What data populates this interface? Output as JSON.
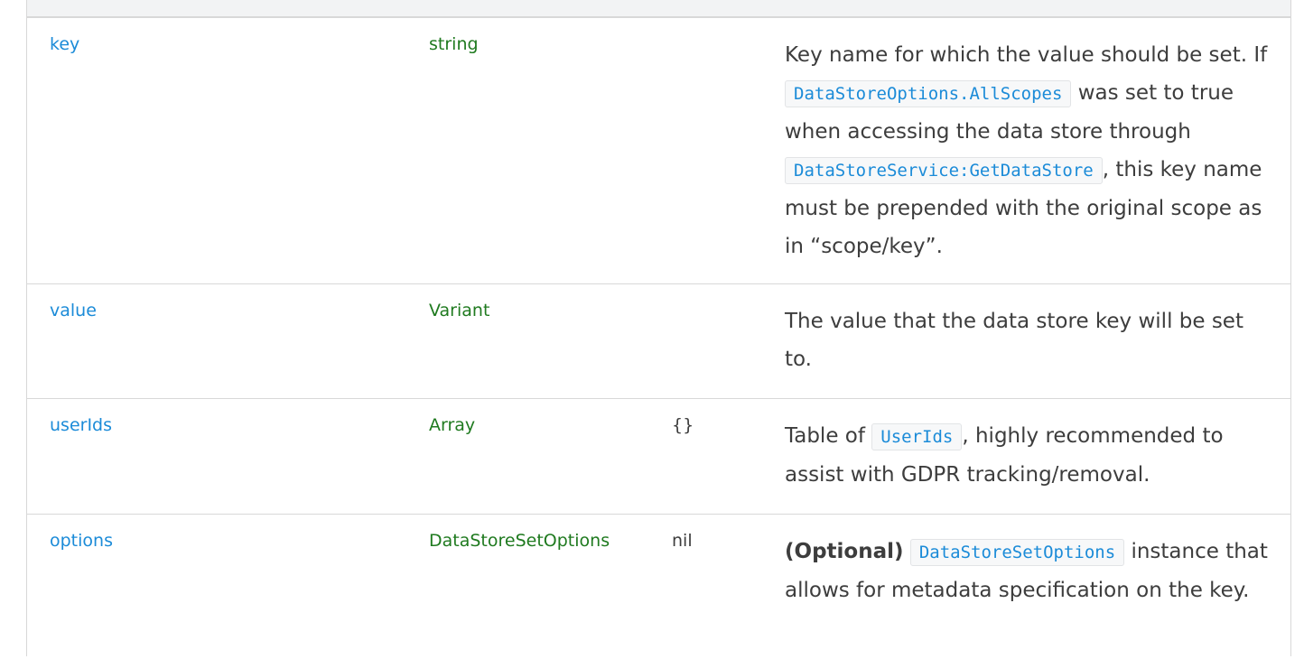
{
  "rows": [
    {
      "name": "key",
      "type": "string",
      "default": "",
      "desc": {
        "t1": "Key name for which the value should be set. If ",
        "code1": "DataStoreOptions.AllScopes",
        "t2": " was set to true when accessing the data store through ",
        "code2": "DataStoreService:GetDataStore",
        "t3": ", this key name must be prepended with the original scope as in “scope/key”."
      }
    },
    {
      "name": "value",
      "type": "Variant",
      "default": "",
      "desc": {
        "t1": "The value that the data store key will be set to."
      }
    },
    {
      "name": "userIds",
      "type": "Array",
      "default": "{}",
      "desc": {
        "t1": "Table of ",
        "code1": "UserIds",
        "t2": ", highly recommended to assist with GDPR tracking/removal."
      }
    },
    {
      "name": "options",
      "type": "DataStoreSetOptions",
      "default": "nil",
      "desc": {
        "bold": "(Optional)",
        "t0": " ",
        "code1": "DataStoreSetOptions",
        "t1": " instance that allows for metadata specification on the key."
      }
    }
  ]
}
